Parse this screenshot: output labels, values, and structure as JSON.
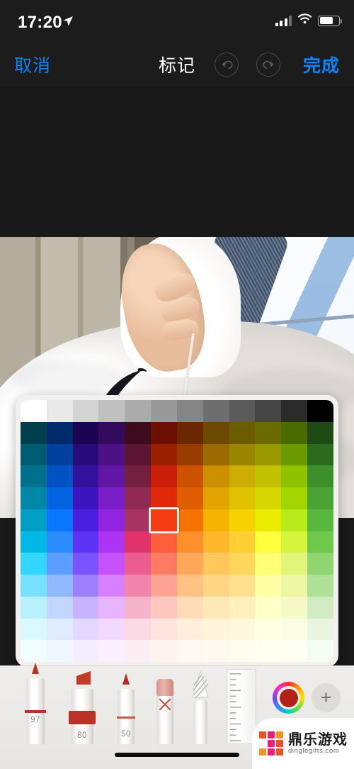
{
  "statusbar": {
    "time": "17:20",
    "location_icon": "location-arrow-icon",
    "cellular_icon": "cellular-bars-icon",
    "wifi_icon": "wifi-icon",
    "battery_icon": "battery-icon",
    "battery_level": 70
  },
  "navbar": {
    "cancel_label": "取消",
    "title": "标记",
    "done_label": "完成",
    "undo_icon": "undo-icon",
    "redo_icon": "redo-icon",
    "undo_enabled": false,
    "redo_enabled": false
  },
  "canvas": {
    "background_color": "#191919",
    "photo_description": "person wearing white fleece hoodie indoors"
  },
  "palette": {
    "columns": 12,
    "rows": 12,
    "selected_index": 65,
    "selected_color": "#cc1f0a",
    "background_color": "#f2f1ef",
    "colors": [
      "#ffffff",
      "#e9e9e9",
      "#d4d4d4",
      "#c0c0c0",
      "#ababab",
      "#999999",
      "#858585",
      "#6e6e6e",
      "#5a5a5a",
      "#454545",
      "#2b2b2b",
      "#000000",
      "#003f4d",
      "#002b6b",
      "#1b0552",
      "#330a5c",
      "#3d0a1e",
      "#6b1000",
      "#6b2800",
      "#6b4a00",
      "#6b5c00",
      "#6b6b00",
      "#4a6b00",
      "#1e4a14",
      "#005c73",
      "#003f9e",
      "#290a7a",
      "#4d1185",
      "#5c1433",
      "#992100",
      "#993c00",
      "#996b00",
      "#998500",
      "#999900",
      "#6b9900",
      "#2b6b1e",
      "#00708c",
      "#0052c2",
      "#33119c",
      "#6116a3",
      "#73203f",
      "#cc1f0a",
      "#cc5200",
      "#cc8f00",
      "#ccad00",
      "#c2c200",
      "#8fc200",
      "#3d8f2b",
      "#0087a8",
      "#0063e0",
      "#3d14bd",
      "#7a1fc7",
      "#8f2b52",
      "#e02a0a",
      "#e05c00",
      "#e0a300",
      "#e0c200",
      "#d6d600",
      "#a3d600",
      "#4aa334",
      "#009ec2",
      "#0a75ff",
      "#4a1fe0",
      "#9124e0",
      "#a83363",
      "#f53d14",
      "#f57300",
      "#f5b400",
      "#f5d200",
      "#ebeb00",
      "#b8eb1b",
      "#57b83d",
      "#00b8e6",
      "#2b8cff",
      "#5c33f5",
      "#ad33f5",
      "#e0336b",
      "#ff5e3d",
      "#ff8f2b",
      "#ffb82b",
      "#ffcf33",
      "#ffff3d",
      "#d6f53d",
      "#6ec94a",
      "#33d6ff",
      "#5c9eff",
      "#7a52ff",
      "#c452ff",
      "#eb5c8f",
      "#ff7a63",
      "#ffa85c",
      "#ffc75c",
      "#ffd65c",
      "#ffff75",
      "#e0f57a",
      "#8fd670",
      "#7ae0ff",
      "#8fb8ff",
      "#9e80ff",
      "#d680ff",
      "#f285ab",
      "#ffa394",
      "#ffc285",
      "#ffd685",
      "#ffe08f",
      "#ffffa3",
      "#ebf7a3",
      "#b0e096",
      "#b8f0ff",
      "#c2d6ff",
      "#c7b3ff",
      "#e8b3ff",
      "#f7b3c9",
      "#ffc7bd",
      "#ffdbb8",
      "#ffe8b8",
      "#fff0bd",
      "#ffffc7",
      "#f5fac7",
      "#d1ebc2",
      "#dbf7ff",
      "#e0ebff",
      "#e3d9ff",
      "#f4d9ff",
      "#fbd9e5",
      "#ffe3dd",
      "#ffeedb",
      "#fff5db",
      "#fff8de",
      "#ffffe3",
      "#fafde3",
      "#e8f5e0",
      "#f0fcff",
      "#f2f7ff",
      "#f3eeff",
      "#fbeeff",
      "#fdeef3",
      "#fff3f0",
      "#fff8f2",
      "#fffaf0",
      "#fffcf0",
      "#fffff2",
      "#fdfff2",
      "#f5fcf2"
    ]
  },
  "tooltray": {
    "background_color": "#eeedeb",
    "tools": [
      {
        "name": "pen-tool",
        "label": "97",
        "selected": false
      },
      {
        "name": "highlighter-tool",
        "label": "80",
        "selected": false
      },
      {
        "name": "pencil-tool",
        "label": "50",
        "selected": false
      },
      {
        "name": "eraser-tool",
        "label": "",
        "selected": false
      },
      {
        "name": "lasso-tool",
        "label": "",
        "selected": false
      },
      {
        "name": "ruler-tool",
        "label": "",
        "selected": false
      }
    ],
    "color_picker": {
      "icon": "color-wheel-icon",
      "current_color": "#b4201a"
    },
    "add_button": {
      "icon": "plus-icon",
      "label": "+"
    }
  },
  "home_indicator": {
    "visible": true
  },
  "watermark": {
    "cn_text": "鼎乐游戏",
    "en_text": "dinglegifts.com",
    "logo_icon": "dingle-squares-logo-icon",
    "logo_colors": [
      "#f04e23",
      "#ec1e79",
      "#f7941e",
      "#ffffff",
      "#ec1e79",
      "#f04e23",
      "#f7941e",
      "#ec1e79",
      "#f04e23"
    ]
  }
}
